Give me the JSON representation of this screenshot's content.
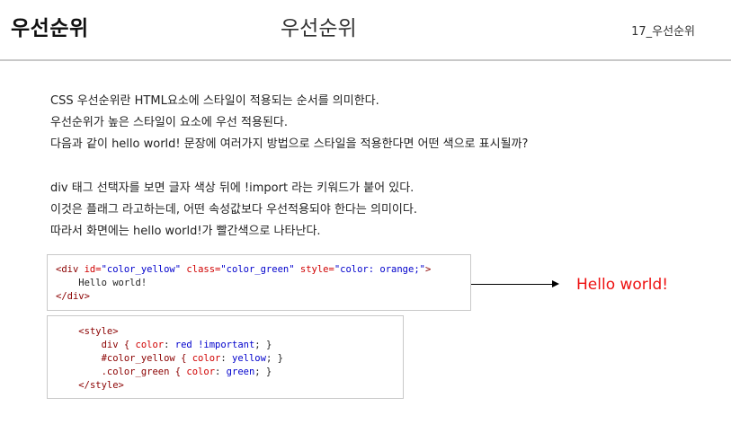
{
  "header": {
    "title_left": "우선순위",
    "title_center": "우선순위",
    "page_label": "17_우선순위"
  },
  "intro": [
    "CSS 우선순위란 HTML요소에 스타일이 적용되는 순서를 의미한다.",
    "우선순위가 높은 스타일이 요소에 우선 적용된다.",
    "다음과 같이 hello world! 문장에 여러가지 방법으로 스타일을 적용한다면 어떤 색으로 표시될까?"
  ],
  "explanation": [
    "div 태그 선택자를 보면 글자 색상 뒤에 !import 라는 키워드가 붙어 있다.",
    "이것은 플래그 라고하는데, 어떤 속성값보다 우선적용되야 한다는 의미이다.",
    "따라서 화면에는 hello world!가 빨간색으로 나타난다."
  ],
  "html_code": {
    "open_tag_start": "<div ",
    "attr_id": "id=",
    "val_id": "\"color_yellow\"",
    "attr_class": "class=",
    "val_class": "\"color_green\"",
    "attr_style": "style=",
    "val_style": "\"color: orange;\"",
    "open_tag_end": ">",
    "content": "    Hello world!",
    "close_tag": "</div>"
  },
  "css_code": {
    "style_open": "<style>",
    "rule1_selector": "div { ",
    "rule1_prop": "color",
    "rule1_colon": ": ",
    "rule1_value": "red !important",
    "rule1_end": "; }",
    "rule2_selector": "#color_yellow { ",
    "rule2_prop": "color",
    "rule2_colon": ": ",
    "rule2_value": "yellow",
    "rule2_end": "; }",
    "rule3_selector": ".color_green { ",
    "rule3_prop": "color",
    "rule3_colon": ": ",
    "rule3_value": "green",
    "rule3_end": "; }",
    "style_close": "</style>"
  },
  "result_text": "Hello world!",
  "colors": {
    "result": "#ee1111",
    "header_rule": "#c8c8c8"
  }
}
